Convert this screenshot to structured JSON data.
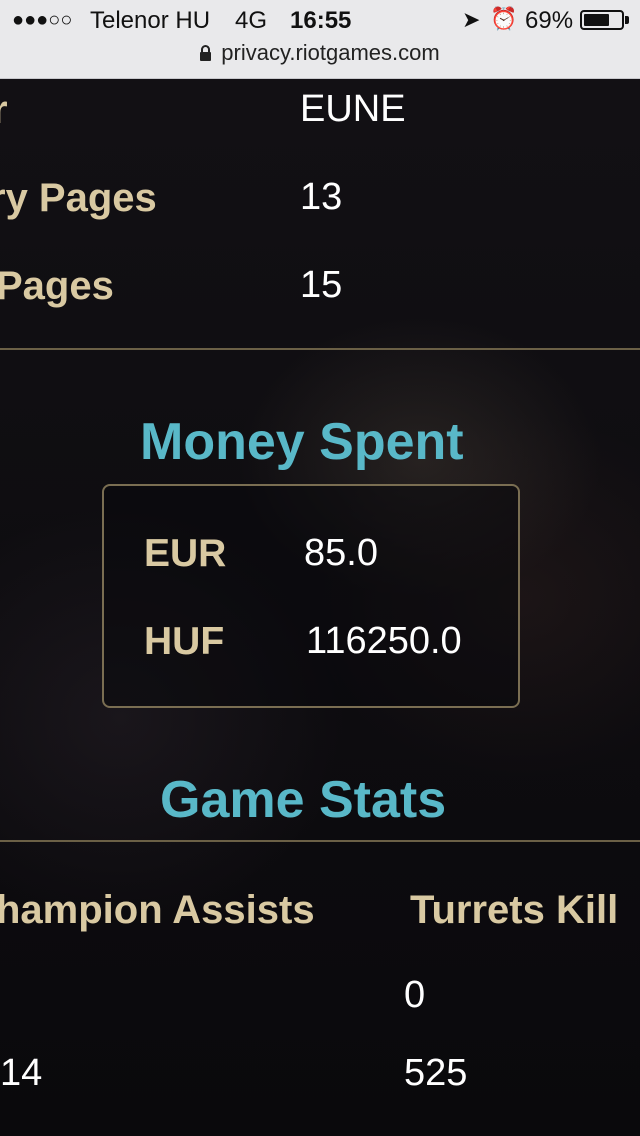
{
  "status_bar": {
    "signal_dots": "●●●○○",
    "carrier": "Telenor HU",
    "network": "4G",
    "time": "16:55",
    "battery_percent": "69%",
    "battery_level": 0.69
  },
  "url_bar": {
    "url": "privacy.riotgames.com"
  },
  "info_rows": [
    {
      "label": "r",
      "value": "EUNE"
    },
    {
      "label": "ry Pages",
      "value": "13"
    },
    {
      "label": "Pages",
      "value": "15"
    }
  ],
  "money_spent": {
    "heading": "Money Spent",
    "rows": [
      {
        "currency": "EUR",
        "amount": "85.0"
      },
      {
        "currency": "HUF",
        "amount": "116250.0"
      }
    ]
  },
  "game_stats": {
    "heading": "Game Stats",
    "columns": [
      "hampion Assists",
      "Turrets Kill"
    ],
    "rows": [
      [
        "",
        "0"
      ],
      [
        "14",
        "525"
      ]
    ]
  },
  "colors": {
    "accent": "#59b8c8",
    "label": "#d9c9a2",
    "divider": "#6b6046"
  }
}
